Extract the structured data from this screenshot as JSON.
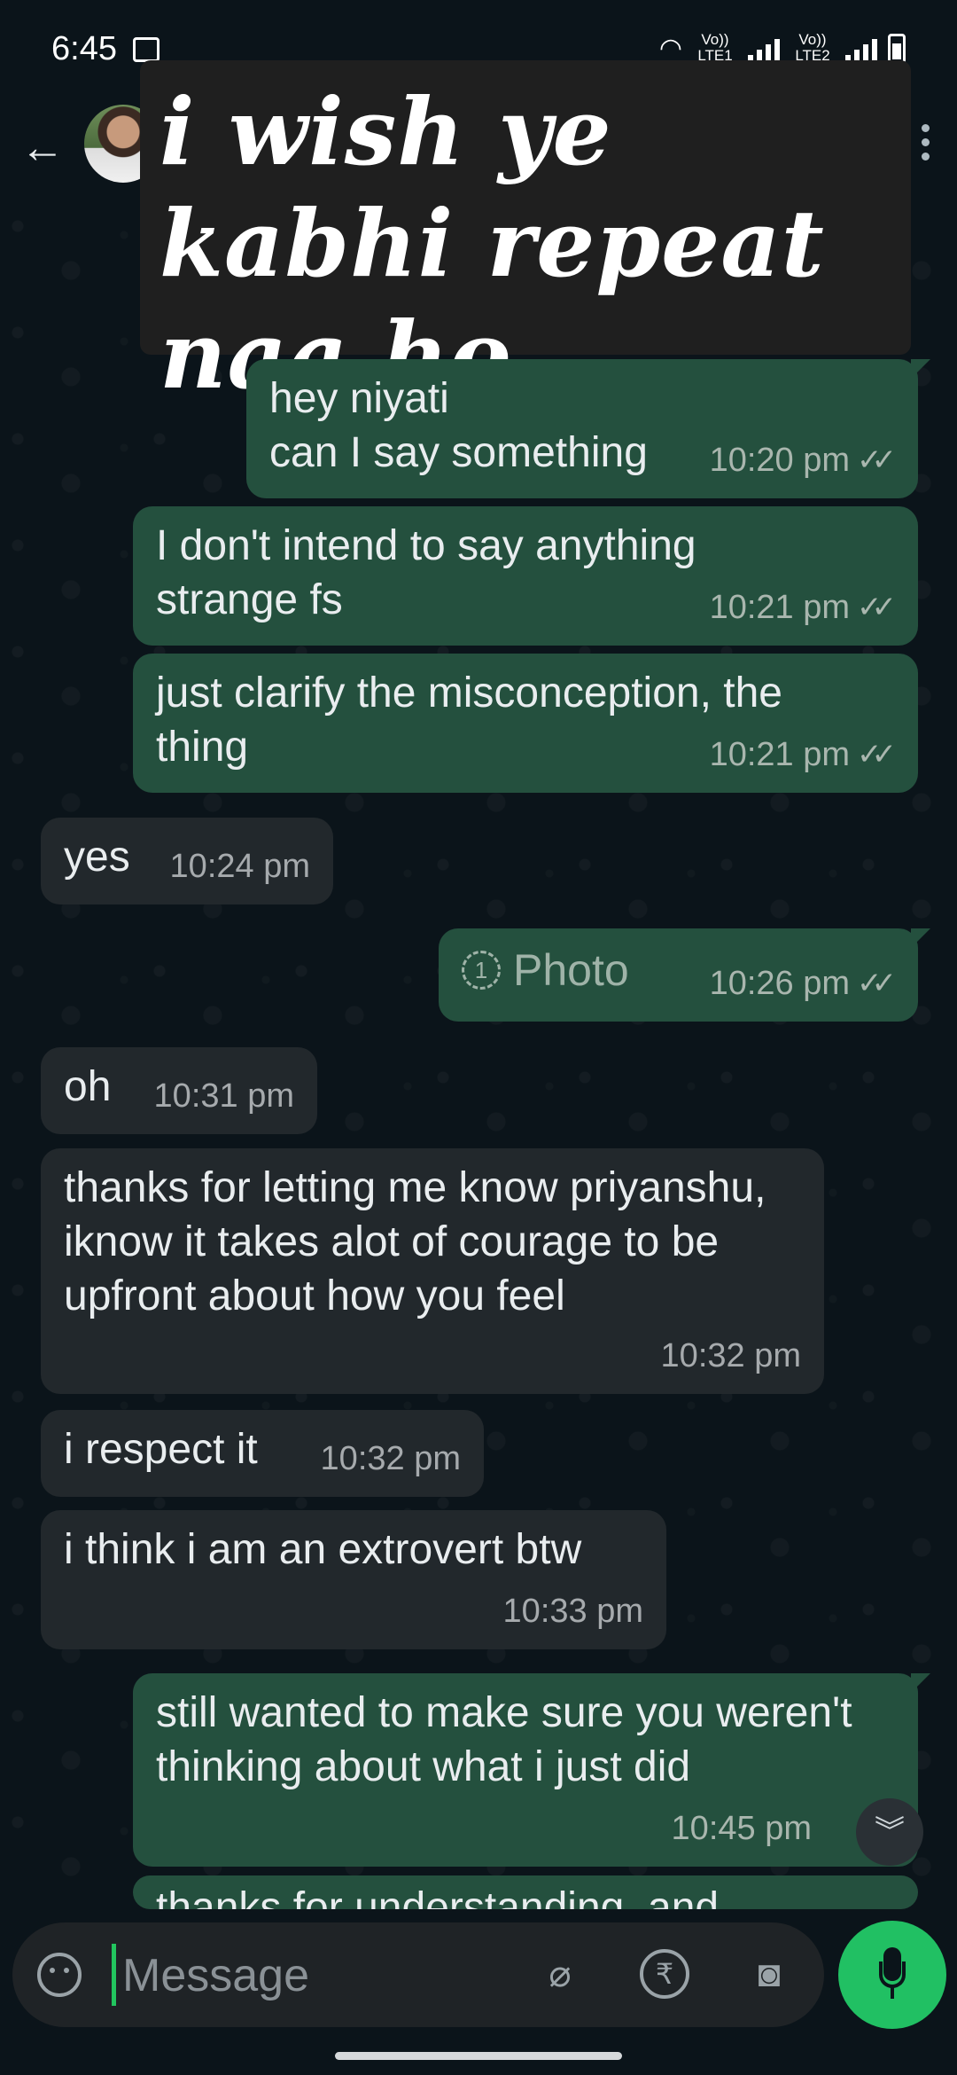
{
  "status_bar": {
    "time": "6:45",
    "sim1": "Vo)) LTE1",
    "sim2": "Vo)) LTE2"
  },
  "header": {
    "back_icon": "arrow-left-icon",
    "menu_icon": "more-vertical-icon"
  },
  "overlay": {
    "text": "i wish ye kabhi repeat naa ho"
  },
  "messages": [
    {
      "dir": "out",
      "text": "hey niyati\ncan I say something",
      "time": "10:20 pm"
    },
    {
      "dir": "out",
      "text": "I don't intend to say anything strange fs",
      "time": "10:21 pm"
    },
    {
      "dir": "out",
      "text": "just clarify the misconception, the thing",
      "time": "10:21 pm"
    },
    {
      "dir": "in",
      "text": "yes",
      "time": "10:24 pm"
    },
    {
      "dir": "out",
      "text": "Photo",
      "time": "10:26 pm",
      "view_once_icon": "view-once-icon",
      "view_once_label": "1"
    },
    {
      "dir": "in",
      "text": "oh",
      "time": "10:31 pm"
    },
    {
      "dir": "in",
      "text": "thanks for letting me know priyanshu, iknow it takes alot of courage to be upfront about how you feel",
      "time": "10:32 pm"
    },
    {
      "dir": "in",
      "text": "i respect it",
      "time": "10:32 pm"
    },
    {
      "dir": "in",
      "text": "i think i am an extrovert btw",
      "time": "10:33 pm"
    },
    {
      "dir": "out",
      "text": "still wanted to make sure you weren't thinking about what i just did",
      "time": "10:45 pm"
    },
    {
      "dir": "out",
      "text": "thanks for understanding, and",
      "time": ""
    }
  ],
  "input": {
    "placeholder": "Message"
  },
  "colors": {
    "outgoing_bubble": "#24503e",
    "incoming_bubble": "#22282c",
    "mic_button": "#21c063",
    "background": "#0b141a"
  }
}
